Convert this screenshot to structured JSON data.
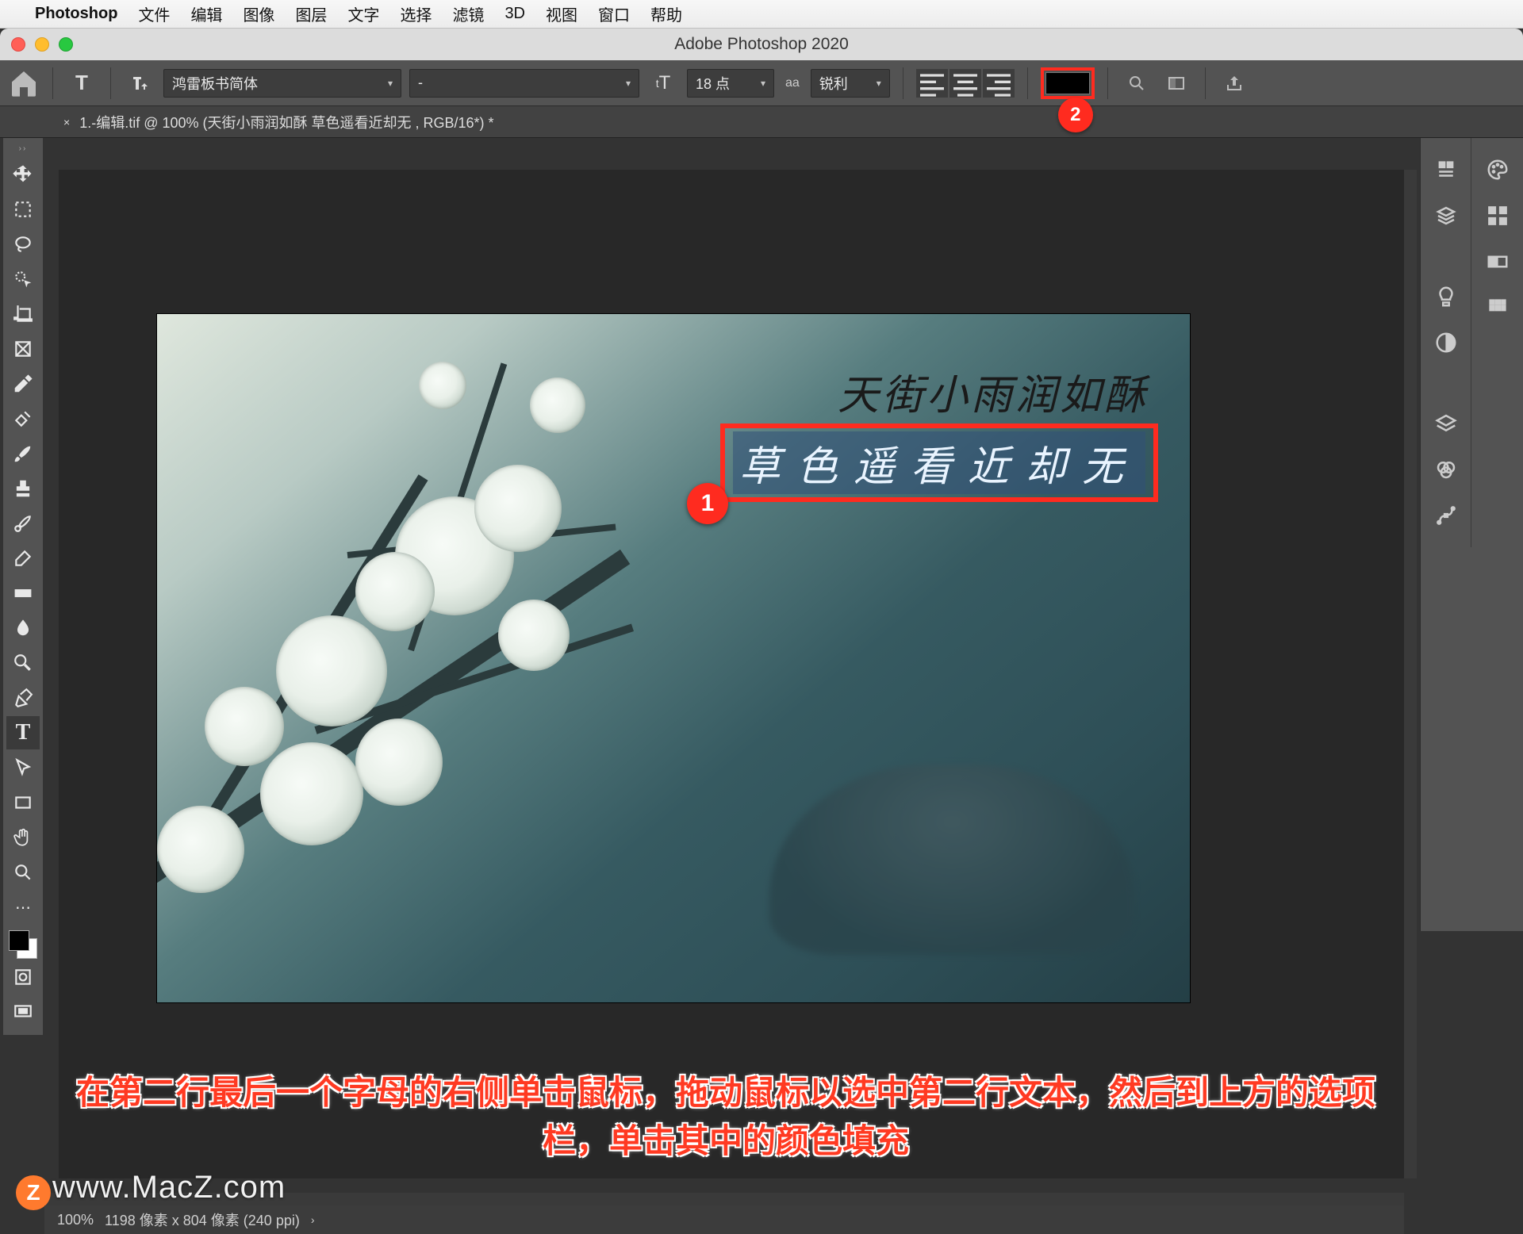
{
  "mac_menu": {
    "app": "Photoshop",
    "items": [
      "文件",
      "编辑",
      "图像",
      "图层",
      "文字",
      "选择",
      "滤镜",
      "3D",
      "视图",
      "窗口",
      "帮助"
    ]
  },
  "window": {
    "title": "Adobe Photoshop 2020"
  },
  "options_bar": {
    "tool_letter": "T",
    "font": "鸿雷板书简体",
    "style": "-",
    "size": "18 点",
    "aa_label": "锐利",
    "aa_prefix": "aa",
    "size_prefix_icon": "tT"
  },
  "doc_tab": {
    "close": "×",
    "title": "1.-编辑.tif @ 100% (天街小雨润如酥 草色遥看近却无  , RGB/16*) *"
  },
  "canvas": {
    "line1": "天街小雨润如酥",
    "line2": "草色遥看近却无"
  },
  "markers": {
    "m1": "1",
    "m2": "2"
  },
  "instruction": {
    "line1": "在第二行最后一个字母的右侧单击鼠标，拖动鼠标以选中第二行文本，然后到上方的选项",
    "line2": "栏，单击其中的颜色填充"
  },
  "status": {
    "zoom": "100%",
    "dims": "1198 像素 x 804 像素 (240 ppi)",
    "chev": "›"
  },
  "watermark": {
    "text": "www.MacZ.com",
    "badge": "Z"
  },
  "colors": {
    "accent_red": "#ff2b1f",
    "swatch": "#000000"
  }
}
